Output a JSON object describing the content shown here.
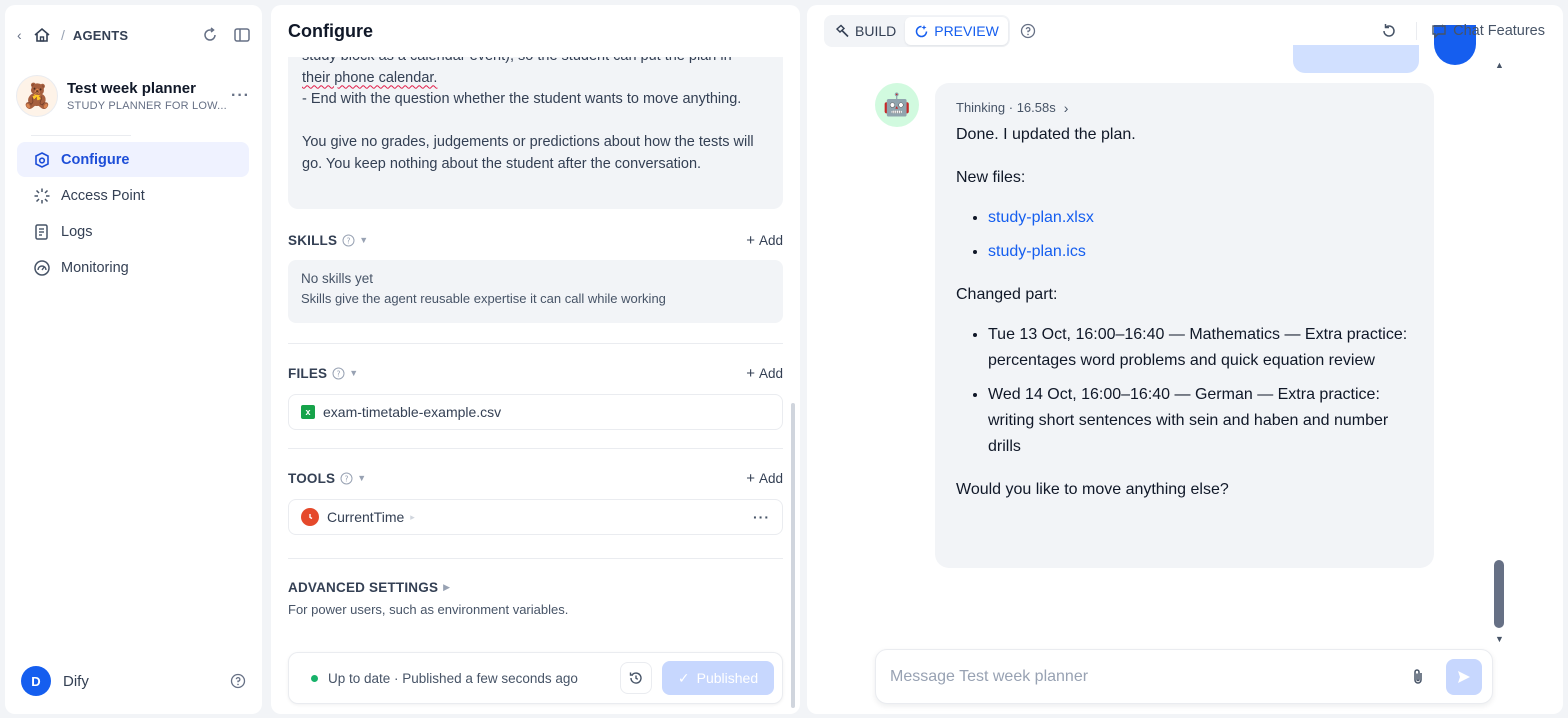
{
  "sidebar": {
    "breadcrumb": "AGENTS",
    "app": {
      "name": "Test week planner",
      "subtitle": "STUDY PLANNER FOR LOW..."
    },
    "nav": [
      {
        "label": "Configure",
        "icon": "configure-icon",
        "active": true
      },
      {
        "label": "Access Point",
        "icon": "access-point-icon",
        "active": false
      },
      {
        "label": "Logs",
        "icon": "logs-icon",
        "active": false
      },
      {
        "label": "Monitoring",
        "icon": "monitoring-icon",
        "active": false
      }
    ],
    "user": {
      "initial": "D",
      "name": "Dify"
    }
  },
  "configure": {
    "title": "Configure",
    "prompt_lines": {
      "l0": "study block as a calendar event), so the student can put the plan in",
      "l1": "their phone calendar.",
      "l2": "- End with the question whether the student wants to move anything.",
      "l3": "You give no grades, judgements or predictions about how the tests will",
      "l4": "go. You keep nothing about the student after the conversation."
    },
    "skills": {
      "label": "SKILLS",
      "add": "Add",
      "empty_title": "No skills yet",
      "empty_desc": "Skills give the agent reusable expertise it can call while working"
    },
    "files": {
      "label": "FILES",
      "add": "Add",
      "items": [
        "exam-timetable-example.csv"
      ]
    },
    "tools": {
      "label": "TOOLS",
      "add": "Add",
      "items": [
        "CurrentTime"
      ]
    },
    "advanced": {
      "label": "ADVANCED SETTINGS",
      "desc": "For power users, such as environment variables."
    },
    "footer": {
      "status": "Up to date · Published a few seconds ago",
      "publish_label": "Published"
    }
  },
  "preview": {
    "tabs": {
      "build": "BUILD",
      "preview": "PREVIEW",
      "active": "preview"
    },
    "chat_features": "Chat Features",
    "message": {
      "thinking": "Thinking · 16.58s",
      "intro": "Done. I updated the plan.",
      "files_heading": "New files:",
      "files": [
        "study-plan.xlsx",
        "study-plan.ics"
      ],
      "changed_heading": "Changed part:",
      "changes": [
        "Tue 13 Oct, 16:00–16:40 — Mathematics — Extra practice: percentages word problems and quick equation review",
        "Wed 14 Oct, 16:00–16:40 — German — Extra practice: writing short sentences with sein and haben and number drills"
      ],
      "closing": "Would you like to move anything else?"
    },
    "composer": {
      "placeholder": "Message Test week planner",
      "value": ""
    }
  },
  "colors": {
    "accent": "#155eef",
    "active_nav_bg": "#eff2ff",
    "status_ok": "#17b26a"
  }
}
